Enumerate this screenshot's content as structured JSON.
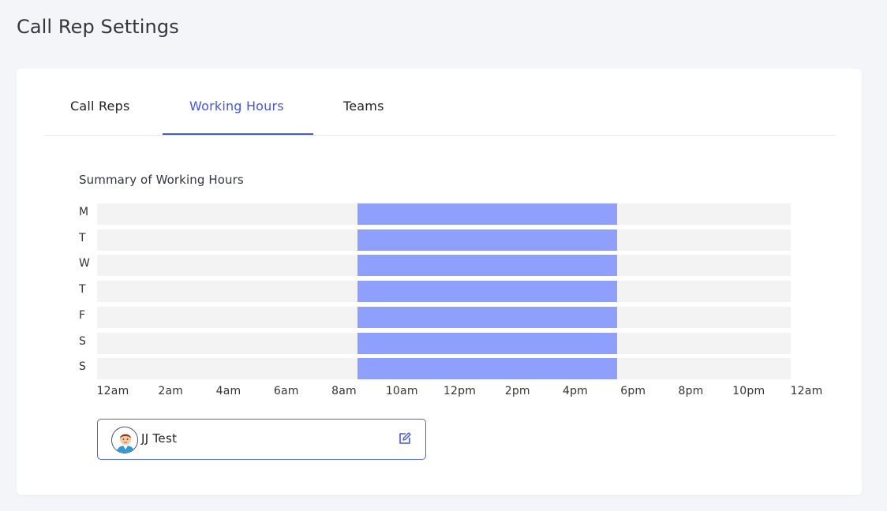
{
  "page": {
    "title": "Call Rep Settings"
  },
  "tabs": [
    {
      "label": "Call Reps",
      "active": false
    },
    {
      "label": "Working Hours",
      "active": true
    },
    {
      "label": "Teams",
      "active": false
    }
  ],
  "summary": {
    "title": "Summary of Working Hours"
  },
  "chart_data": {
    "type": "bar",
    "title": "Summary of Working Hours",
    "categories": [
      "M",
      "T",
      "W",
      "T",
      "F",
      "S",
      "S"
    ],
    "x_ticks": [
      "12am",
      "2am",
      "4am",
      "6am",
      "8am",
      "10am",
      "12pm",
      "2pm",
      "4pm",
      "6pm",
      "8pm",
      "10pm",
      "12am"
    ],
    "xlim_hours": [
      0,
      24
    ],
    "series": [
      {
        "start_hour": [
          9,
          9,
          9,
          9,
          9,
          9,
          9
        ],
        "end_hour": [
          18,
          18,
          18,
          18,
          18,
          18,
          18
        ]
      }
    ],
    "colors": {
      "working": "#8f9ffc",
      "background": "#f3f3f3"
    }
  },
  "rep": {
    "name": "JJ Test",
    "avatar_icon": "user-avatar-icon",
    "edit_icon": "edit-icon"
  },
  "colors": {
    "accent": "#4456e3"
  }
}
